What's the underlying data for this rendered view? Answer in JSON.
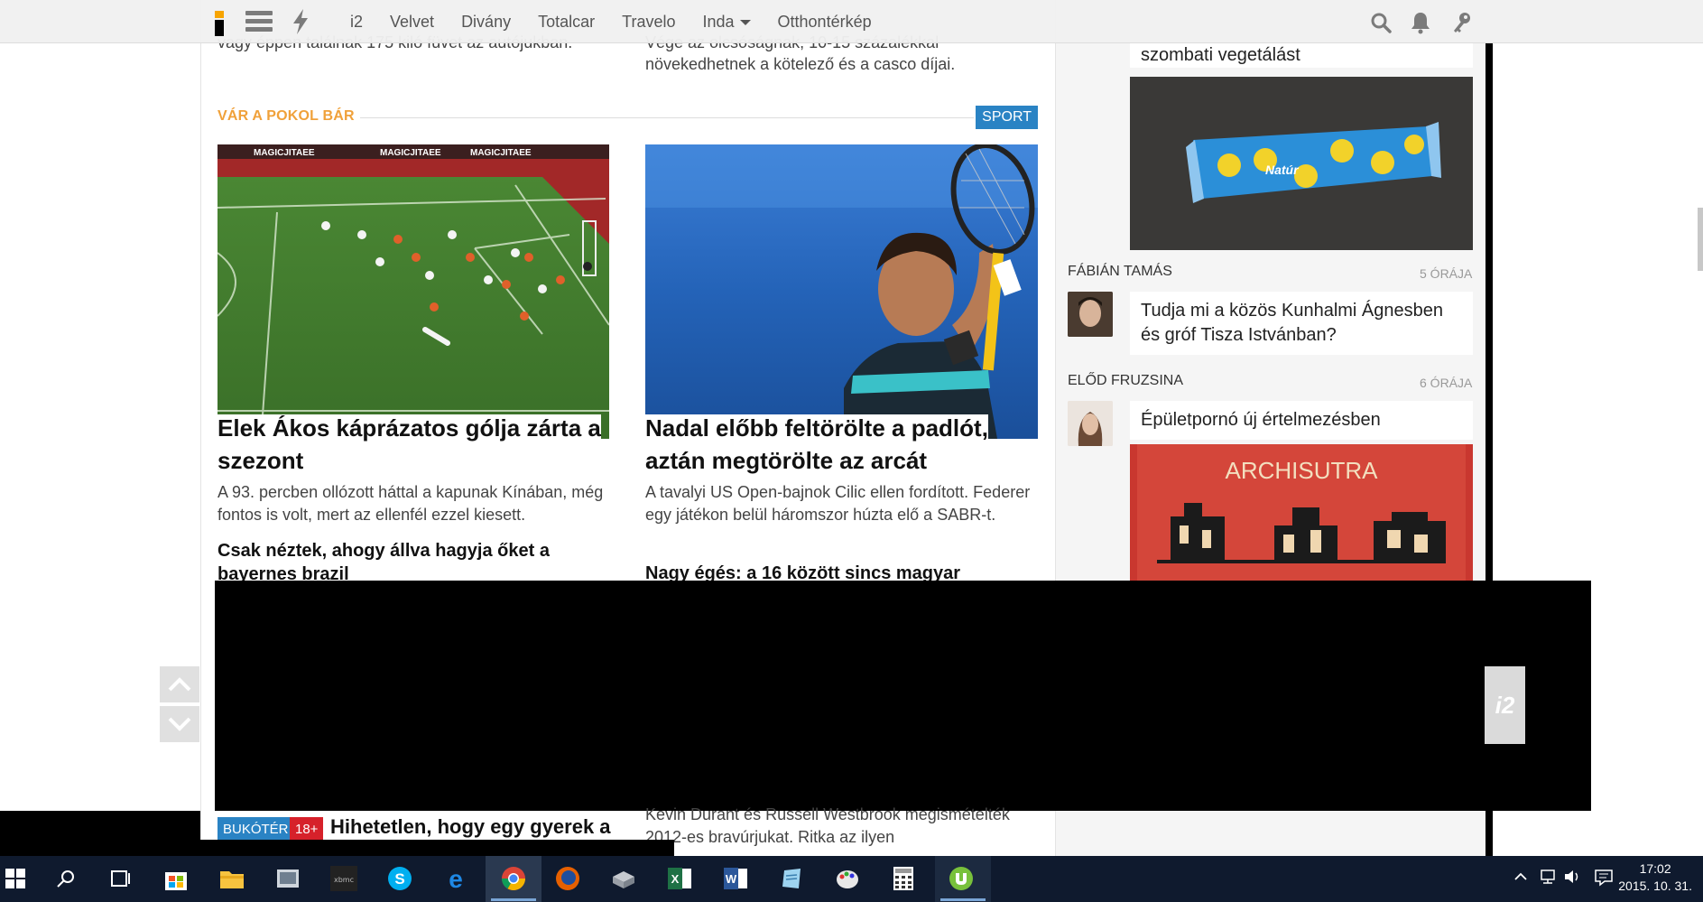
{
  "nav": {
    "links": [
      "i2",
      "Velvet",
      "Divány",
      "Totalcar",
      "Travelo",
      "Inda",
      "Otthontérkép"
    ]
  },
  "under_nav": {
    "left_line": "vagy éppen találnak 175 kiló füvet az autójukban.",
    "mid_line": "Vége az olcsóságnak, 10-15 százalékkal növekedhetnek a kötelező és a casco díjai."
  },
  "section": {
    "title": "VÁR A POKOL BÁR",
    "tag": "SPORT"
  },
  "articles": [
    {
      "headline": "Elek Ákos káprázatos gólja zárta a szezont",
      "lead": "A 93. percben ollózott háttal a kapunak Kínában, még fontos is volt, mert az ellenfél ezzel kiesett.",
      "sublink": "Csak néztek, ahogy állva hagyja őket a bayernes brazil",
      "image_banner": "MAGICJITAEE"
    },
    {
      "headline": "Nadal előbb feltörölte a padlót, aztán megtörölte az arcát",
      "lead": "A tavalyi US Open-bajnok Cilic ellen fordított. Federer egy játékon belül háromszor húzta elő a SABR-t.",
      "sublink": "Nagy égés: a 16 között sincs magyar"
    }
  ],
  "sidebar": {
    "top_text": "szombati vegetálást",
    "candy_brand": "Natúr",
    "items": [
      {
        "author": "FÁBIÁN TAMÁS",
        "time": "5 ÓRÁJA",
        "text": "Tudja mi a közös Kunhalmi Ágnesben és gróf Tisza Istvánban?"
      },
      {
        "author": "ELŐD FRUZSINA",
        "time": "6 ÓRÁJA",
        "text": "Épületpornó új értelmezésben",
        "image_title": "ARCHISUTRA"
      }
    ]
  },
  "overlay": {
    "badge": "i2"
  },
  "bottom": {
    "badge1": "BUKÓTÉR",
    "badge2": "18+",
    "headline": "Hihetetlen, hogy egy gyerek a",
    "right_lead": "Kevin Durant és Russell Westbrook megismételték 2012-es bravúrjukat. Ritka az ilyen"
  },
  "taskbar": {
    "clock_time": "17:02",
    "clock_date": "2015. 10. 31.",
    "apps": [
      "start-icon",
      "search-icon",
      "task-view-icon",
      "store-icon",
      "file-explorer-icon",
      "photos-icon",
      "xbmc-icon",
      "skype-icon",
      "edge-icon",
      "chrome-icon",
      "firefox-icon",
      "installer-icon",
      "excel-icon",
      "word-icon",
      "notepad-icon",
      "paint-icon",
      "calculator-icon",
      "utorrent-icon"
    ]
  },
  "colors": {
    "accent_orange": "#f0a13a",
    "tag_blue": "#2a83c4",
    "badge_red": "#d6212a",
    "taskbar": "#0f1a2e"
  }
}
